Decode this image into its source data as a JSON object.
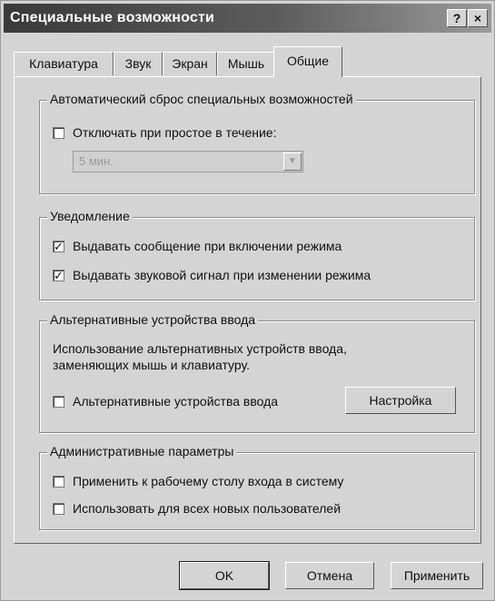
{
  "window": {
    "title": "Специальные возможности",
    "help_glyph": "?",
    "close_glyph": "×"
  },
  "tabs": [
    {
      "label": "Клавиатура",
      "active": false
    },
    {
      "label": "Звук",
      "active": false
    },
    {
      "label": "Экран",
      "active": false
    },
    {
      "label": "Мышь",
      "active": false
    },
    {
      "label": "Общие",
      "active": true
    }
  ],
  "autoreset": {
    "legend": "Автоматический сброс специальных возможностей",
    "checkbox": {
      "label": "Отключать при простое в течение:",
      "checked": false
    },
    "select": {
      "value": "5 мин."
    }
  },
  "notify": {
    "legend": "Уведомление",
    "items": [
      {
        "label": "Выдавать сообщение при включении режима",
        "checked": true
      },
      {
        "label": "Выдавать звуковой сигнал при изменении режима",
        "checked": true
      }
    ]
  },
  "alt_input": {
    "legend": "Альтернативные устройства ввода",
    "desc_line1": "Использование альтернативных устройств ввода,",
    "desc_line2": "заменяющих мышь и клавиатуру.",
    "checkbox": {
      "label": "Альтернативные устройства ввода",
      "checked": false
    },
    "settings_button": "Настройка"
  },
  "admin": {
    "legend": "Административные параметры",
    "items": [
      {
        "label": "Применить к рабочему столу входа в систему",
        "checked": false
      },
      {
        "label": "Использовать для всех новых пользователей",
        "checked": false
      }
    ]
  },
  "buttons": {
    "ok": "OK",
    "cancel": "Отмена",
    "apply": "Применить"
  },
  "check_glyph": "✓"
}
